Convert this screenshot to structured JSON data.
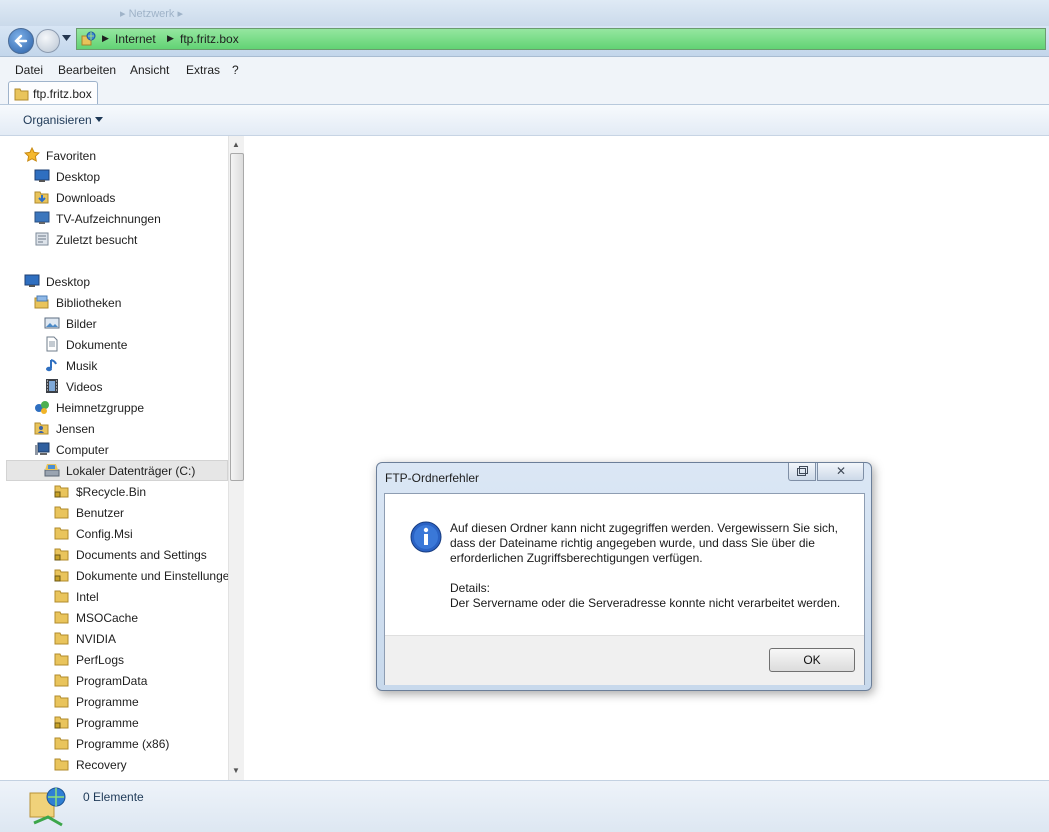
{
  "titlebar": {
    "ghost_text": "▸ Netzwerk ▸"
  },
  "address": {
    "crumbs": [
      "Internet",
      "ftp.fritz.box"
    ],
    "color": "#62d374"
  },
  "menu": {
    "items": [
      "Datei",
      "Bearbeiten",
      "Ansicht",
      "Extras",
      "?"
    ]
  },
  "tab": {
    "label": "ftp.fritz.box"
  },
  "command": {
    "organize": "Organisieren"
  },
  "navpane": {
    "favorites": {
      "label": "Favoriten",
      "items": [
        "Desktop",
        "Downloads",
        "TV-Aufzeichnungen",
        "Zuletzt besucht"
      ]
    },
    "desktop": "Desktop",
    "libraries": {
      "label": "Bibliotheken",
      "items": [
        "Bilder",
        "Dokumente",
        "Musik",
        "Videos"
      ]
    },
    "homegroup": "Heimnetzgruppe",
    "user": "Jensen",
    "computer": "Computer",
    "drive": "Lokaler Datenträger (C:)",
    "folders": [
      "$Recycle.Bin",
      "Benutzer",
      "Config.Msi",
      "Documents and Settings",
      "Dokumente und Einstellungen",
      "Intel",
      "MSOCache",
      "NVIDIA",
      "PerfLogs",
      "ProgramData",
      "Programme",
      "Programme",
      "Programme (x86)",
      "Recovery"
    ]
  },
  "details": {
    "count": "0 Elemente"
  },
  "dialog": {
    "title": "FTP-Ordnerfehler",
    "close_glyph": "✕",
    "message": "Auf diesen Ordner kann nicht zugegriffen werden. Vergewissern Sie sich, dass der Dateiname richtig angegeben wurde, und dass Sie über die erforderlichen Zugriffsberechtigungen verfügen.",
    "details_label": "Details:",
    "details_text": "Der Servername oder die Serveradresse konnte nicht verarbeitet werden.",
    "ok_label": "OK"
  }
}
